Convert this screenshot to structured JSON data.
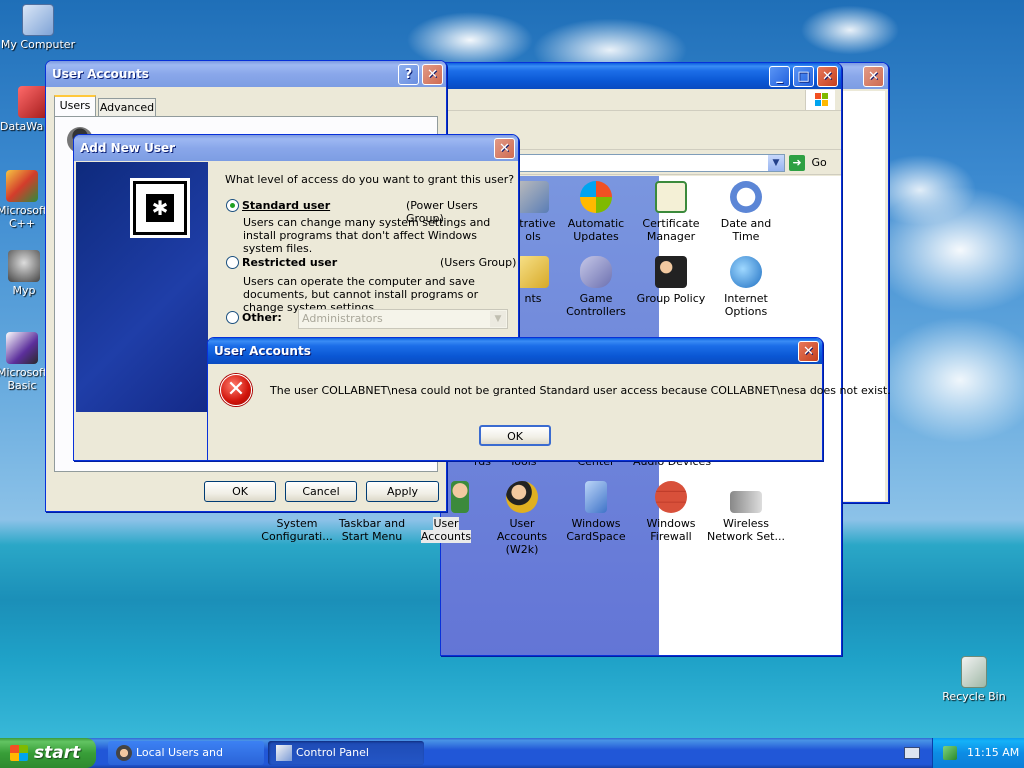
{
  "desktop": {
    "icons": [
      {
        "label": "My Computer"
      },
      {
        "label": "DataWa"
      },
      {
        "label": "Microsoft C++"
      },
      {
        "label": "Myp"
      },
      {
        "label": "Microsoft Basic"
      },
      {
        "label": "Recycle Bin"
      }
    ]
  },
  "control_panel": {
    "go_label": "Go",
    "icons": [
      {
        "label": "istrative ols"
      },
      {
        "label": "Automatic Updates"
      },
      {
        "label": "Certificate Manager"
      },
      {
        "label": "Date and Time"
      },
      {
        "label": "nts"
      },
      {
        "label": "Game Controllers"
      },
      {
        "label": "Group Policy"
      },
      {
        "label": "Internet Options"
      },
      {
        "label": "rds"
      },
      {
        "label": "Tools"
      },
      {
        "label": "Center"
      },
      {
        "label": "Audio Devices"
      },
      {
        "label": "System Configurati..."
      },
      {
        "label": "Taskbar and Start Menu"
      },
      {
        "label": "User Accounts"
      },
      {
        "label": "User Accounts (W2k)"
      },
      {
        "label": "Windows CardSpace"
      },
      {
        "label": "Windows Firewall"
      },
      {
        "label": "Wireless Network Set..."
      }
    ]
  },
  "user_accounts": {
    "title": "User Accounts",
    "tabs": [
      "Users",
      "Advanced"
    ],
    "ok_label": "OK",
    "cancel_label": "Cancel",
    "apply_label": "Apply"
  },
  "add_new_user": {
    "title": "Add New User",
    "question": "What level of access do you want to grant this user?",
    "options": [
      {
        "label": "Standard user",
        "group": "(Power Users Group)",
        "description": "Users can change many system settings and install programs that don't affect Windows system files."
      },
      {
        "label": "Restricted user",
        "group": "(Users Group)",
        "description": "Users can operate the computer and save documents, but cannot install programs or change system settings."
      },
      {
        "label": "Other:",
        "select_value": "Administrators"
      }
    ]
  },
  "error_dialog": {
    "title": "User Accounts",
    "message": "The user COLLABNET\\nesa could not be granted Standard user access because COLLABNET\\nesa does not exist.",
    "ok_label": "OK"
  },
  "taskbar": {
    "start_label": "start",
    "tasks": [
      {
        "label": "Local Users and Groups"
      },
      {
        "label": "Control Panel"
      }
    ],
    "clock": "11:15 AM"
  }
}
